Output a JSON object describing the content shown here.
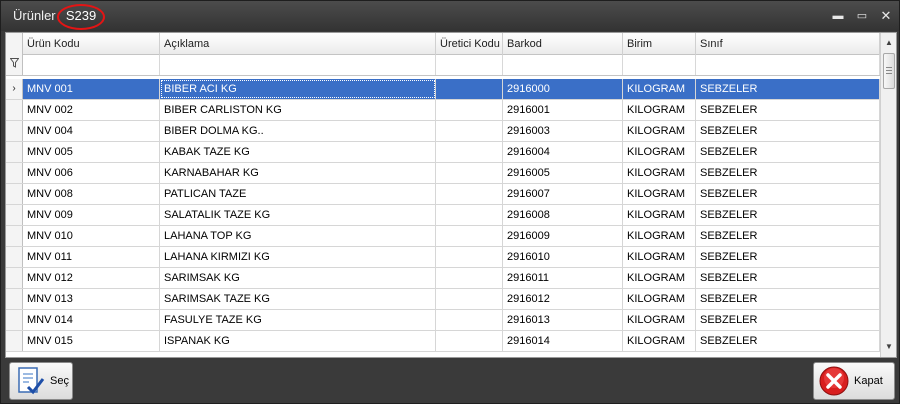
{
  "window": {
    "title": "Ürünler",
    "code": "S239",
    "controls": {
      "minimize": "▬",
      "maximize": "▭",
      "close": "✕"
    }
  },
  "grid": {
    "columns": [
      "Ürün Kodu",
      "Açıklama",
      "Üretici Kodu",
      "Barkod",
      "Birim",
      "Sınıf"
    ],
    "selected_indicator": "›",
    "rows": [
      [
        "MNV 001",
        "BIBER ACI KG",
        "",
        "2916000",
        "KILOGRAM",
        "SEBZELER"
      ],
      [
        "MNV 002",
        "BIBER CARLISTON KG",
        "",
        "2916001",
        "KILOGRAM",
        "SEBZELER"
      ],
      [
        "MNV 004",
        "BIBER DOLMA KG..",
        "",
        "2916003",
        "KILOGRAM",
        "SEBZELER"
      ],
      [
        "MNV 005",
        "KABAK TAZE KG",
        "",
        "2916004",
        "KILOGRAM",
        "SEBZELER"
      ],
      [
        "MNV 006",
        "KARNABAHAR KG",
        "",
        "2916005",
        "KILOGRAM",
        "SEBZELER"
      ],
      [
        "MNV 008",
        "PATLICAN TAZE",
        "",
        "2916007",
        "KILOGRAM",
        "SEBZELER"
      ],
      [
        "MNV 009",
        "SALATALIK TAZE KG",
        "",
        "2916008",
        "KILOGRAM",
        "SEBZELER"
      ],
      [
        "MNV 010",
        "LAHANA TOP KG",
        "",
        "2916009",
        "KILOGRAM",
        "SEBZELER"
      ],
      [
        "MNV 011",
        "LAHANA KIRMIZI KG",
        "",
        "2916010",
        "KILOGRAM",
        "SEBZELER"
      ],
      [
        "MNV 012",
        "SARIMSAK KG",
        "",
        "2916011",
        "KILOGRAM",
        "SEBZELER"
      ],
      [
        "MNV 013",
        "SARIMSAK TAZE KG",
        "",
        "2916012",
        "KILOGRAM",
        "SEBZELER"
      ],
      [
        "MNV 014",
        "FASULYE TAZE KG",
        "",
        "2916013",
        "KILOGRAM",
        "SEBZELER"
      ],
      [
        "MNV 015",
        "ISPANAK  KG",
        "",
        "2916014",
        "KILOGRAM",
        "SEBZELER"
      ]
    ],
    "selected_row": 0
  },
  "buttons": {
    "select_label": "Seç",
    "close_label": "Kapat"
  },
  "colors": {
    "selection": "#3a6fc7",
    "title_highlight": "#e41414",
    "close_icon": "#d81e1e"
  },
  "icons": {
    "select": "document-check-icon",
    "close": "red-x-circle-icon",
    "filter": "funnel-icon"
  }
}
